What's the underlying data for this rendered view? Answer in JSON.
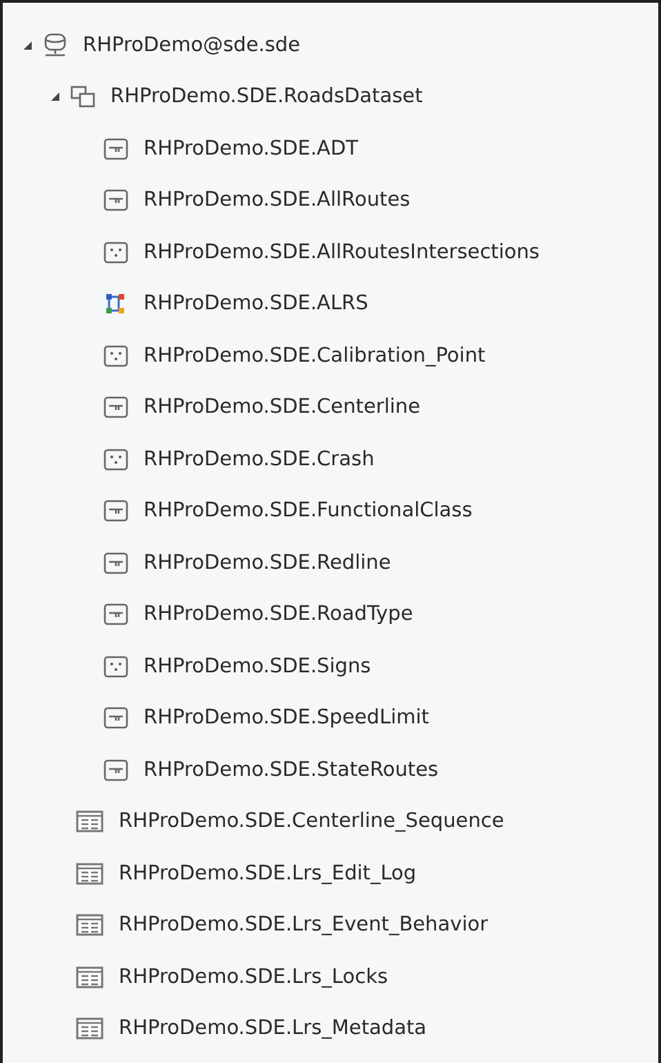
{
  "tree": [
    {
      "label": "RHProDemo@sde.sde",
      "kind": "database",
      "expanded": true,
      "children": [
        {
          "label": "RHProDemo.SDE.RoadsDataset",
          "kind": "dataset",
          "expanded": true,
          "children": [
            {
              "label": "RHProDemo.SDE.ADT",
              "kind": "line"
            },
            {
              "label": "RHProDemo.SDE.AllRoutes",
              "kind": "line"
            },
            {
              "label": "RHProDemo.SDE.AllRoutesIntersections",
              "kind": "point"
            },
            {
              "label": "RHProDemo.SDE.ALRS",
              "kind": "network"
            },
            {
              "label": "RHProDemo.SDE.Calibration_Point",
              "kind": "point"
            },
            {
              "label": "RHProDemo.SDE.Centerline",
              "kind": "line"
            },
            {
              "label": "RHProDemo.SDE.Crash",
              "kind": "point"
            },
            {
              "label": "RHProDemo.SDE.FunctionalClass",
              "kind": "line"
            },
            {
              "label": "RHProDemo.SDE.Redline",
              "kind": "line"
            },
            {
              "label": "RHProDemo.SDE.RoadType",
              "kind": "line"
            },
            {
              "label": "RHProDemo.SDE.Signs",
              "kind": "point"
            },
            {
              "label": "RHProDemo.SDE.SpeedLimit",
              "kind": "line"
            },
            {
              "label": "RHProDemo.SDE.StateRoutes",
              "kind": "line"
            }
          ]
        },
        {
          "label": "RHProDemo.SDE.Centerline_Sequence",
          "kind": "table"
        },
        {
          "label": "RHProDemo.SDE.Lrs_Edit_Log",
          "kind": "table"
        },
        {
          "label": "RHProDemo.SDE.Lrs_Event_Behavior",
          "kind": "table"
        },
        {
          "label": "RHProDemo.SDE.Lrs_Locks",
          "kind": "table"
        },
        {
          "label": "RHProDemo.SDE.Lrs_Metadata",
          "kind": "table"
        }
      ]
    }
  ]
}
